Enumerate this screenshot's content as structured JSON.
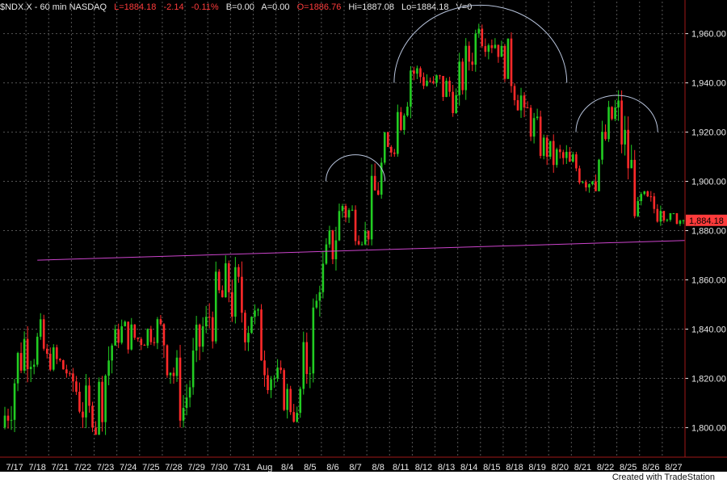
{
  "header": {
    "symbol": "$NDX.X - 60 min  NASDAQ",
    "last": "L=1884.18",
    "change": "-2.14",
    "change_pct": "-0.11%",
    "bid": "B=0.00",
    "ask": "A=0.00",
    "open": "O=1886.76",
    "high": "Hi=1887.08",
    "low": "Lo=1884.18",
    "volume": "V=0"
  },
  "last_price_tag": "1,884.18",
  "footer": "Created with TradeStation",
  "colors": {
    "up": "#22cc22",
    "down": "#ff2a2a",
    "trendline": "#cc44cc",
    "arcs": "#b8c4dc",
    "grid": "#555555",
    "border": "#a01818",
    "axis_text": "#e8e8e8",
    "price_tag": "#ff3b3b"
  },
  "chart_data": {
    "type": "candlestick",
    "ylim": [
      1788,
      1973
    ],
    "y_ticks": [
      1800,
      1820,
      1840,
      1860,
      1880,
      1900,
      1920,
      1940,
      1960
    ],
    "y_tick_labels": [
      "1,800.00",
      "1,820.00",
      "1,840.00",
      "1,860.00",
      "1,880.00",
      "1,900.00",
      "1,920.00",
      "1,940.00",
      "1,960.00"
    ],
    "x_labels": [
      "7/17",
      "7/18",
      "7/21",
      "7/22",
      "7/23",
      "7/24",
      "7/25",
      "7/28",
      "7/29",
      "7/30",
      "7/31",
      "Aug",
      "8/4",
      "8/5",
      "8/6",
      "8/7",
      "8/8",
      "8/11",
      "8/12",
      "8/13",
      "8/14",
      "8/15",
      "8/18",
      "8/19",
      "8/20",
      "8/21",
      "8/22",
      "8/25",
      "8/26",
      "8/27"
    ],
    "sessions": [
      {
        "label": "7/17",
        "start": 1800,
        "end": 1836,
        "low": 1797,
        "high": 1850
      },
      {
        "label": "7/18",
        "start": 1836,
        "end": 1830,
        "low": 1818,
        "high": 1864
      },
      {
        "label": "7/21",
        "start": 1830,
        "end": 1822,
        "low": 1815,
        "high": 1838
      },
      {
        "label": "7/22",
        "start": 1822,
        "end": 1800,
        "low": 1790,
        "high": 1832
      },
      {
        "label": "7/23",
        "start": 1800,
        "end": 1840,
        "low": 1797,
        "high": 1852
      },
      {
        "label": "7/24",
        "start": 1840,
        "end": 1836,
        "low": 1826,
        "high": 1852
      },
      {
        "label": "7/25",
        "start": 1836,
        "end": 1842,
        "low": 1828,
        "high": 1850
      },
      {
        "label": "7/28",
        "start": 1842,
        "end": 1808,
        "low": 1800,
        "high": 1848
      },
      {
        "label": "7/29",
        "start": 1808,
        "end": 1845,
        "low": 1805,
        "high": 1852
      },
      {
        "label": "7/30",
        "start": 1845,
        "end": 1855,
        "low": 1820,
        "high": 1872
      },
      {
        "label": "7/31",
        "start": 1855,
        "end": 1845,
        "low": 1815,
        "high": 1873
      },
      {
        "label": "Aug",
        "start": 1845,
        "end": 1820,
        "low": 1812,
        "high": 1858
      },
      {
        "label": "8/4",
        "start": 1820,
        "end": 1806,
        "low": 1802,
        "high": 1832
      },
      {
        "label": "8/5",
        "start": 1806,
        "end": 1855,
        "low": 1804,
        "high": 1862
      },
      {
        "label": "8/6",
        "start": 1855,
        "end": 1890,
        "low": 1850,
        "high": 1897
      },
      {
        "label": "8/7",
        "start": 1890,
        "end": 1880,
        "low": 1874,
        "high": 1905
      },
      {
        "label": "8/8",
        "start": 1880,
        "end": 1914,
        "low": 1874,
        "high": 1920
      },
      {
        "label": "8/11",
        "start": 1914,
        "end": 1945,
        "low": 1910,
        "high": 1958
      },
      {
        "label": "8/12",
        "start": 1945,
        "end": 1940,
        "low": 1930,
        "high": 1955
      },
      {
        "label": "8/13",
        "start": 1940,
        "end": 1935,
        "low": 1922,
        "high": 1952
      },
      {
        "label": "8/14",
        "start": 1935,
        "end": 1962,
        "low": 1930,
        "high": 1968
      },
      {
        "label": "8/15",
        "start": 1962,
        "end": 1955,
        "low": 1945,
        "high": 1972
      },
      {
        "label": "8/18",
        "start": 1955,
        "end": 1930,
        "low": 1925,
        "high": 1962
      },
      {
        "label": "8/19",
        "start": 1930,
        "end": 1910,
        "low": 1905,
        "high": 1935
      },
      {
        "label": "8/20",
        "start": 1910,
        "end": 1908,
        "low": 1898,
        "high": 1925
      },
      {
        "label": "8/21",
        "start": 1908,
        "end": 1900,
        "low": 1886,
        "high": 1912
      },
      {
        "label": "8/22",
        "start": 1900,
        "end": 1930,
        "low": 1896,
        "high": 1935
      },
      {
        "label": "8/25",
        "start": 1930,
        "end": 1892,
        "low": 1885,
        "high": 1937
      },
      {
        "label": "8/26",
        "start": 1892,
        "end": 1888,
        "low": 1876,
        "high": 1898
      },
      {
        "label": "8/27",
        "start": 1888,
        "end": 1884.18,
        "low": 1875,
        "high": 1887.08
      }
    ],
    "trendline": {
      "from": {
        "x": "7/18",
        "y": 1868
      },
      "to": {
        "x": "8/27",
        "y": 1876
      }
    },
    "arcs": [
      {
        "from": "8/6",
        "to": "8/8",
        "level": 1900
      },
      {
        "from": "8/11",
        "to": "8/20",
        "level": 1940
      },
      {
        "from": "8/21",
        "to": "8/26",
        "level": 1920
      }
    ],
    "grid": true
  }
}
